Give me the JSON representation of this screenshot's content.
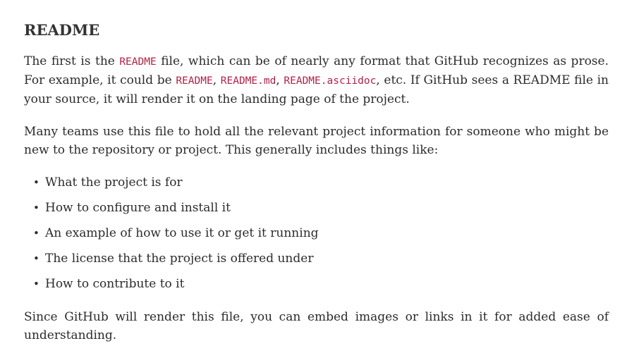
{
  "section": {
    "title": "README"
  },
  "paragraph1": {
    "t1": "The first is the ",
    "code1": "README",
    "t2": " file, which can be of nearly any format that GitHub recognizes as prose. For example, it could be ",
    "code2": "README",
    "sep1": ", ",
    "code3": "README.md",
    "sep2": ", ",
    "code4": "README.asciidoc",
    "t3": ", etc. If GitHub sees a README file in your source, it will render it on the landing page of the project."
  },
  "paragraph2": {
    "text": "Many teams use this file to hold all the relevant project information for someone who might be new to the repository or project. This generally includes things like:"
  },
  "list": {
    "bullet_char": "•",
    "items": [
      "What the project is for",
      "How to configure and install it",
      "An example of how to use it or get it running",
      "The license that the project is offered under",
      "How to contribute to it"
    ]
  },
  "paragraph3": {
    "text": "Since GitHub will render this file, you can embed images or links in it for added ease of understanding."
  },
  "colors": {
    "code_text": "#b12146",
    "body_text": "#2b2b2b",
    "heading_text": "#333333"
  }
}
